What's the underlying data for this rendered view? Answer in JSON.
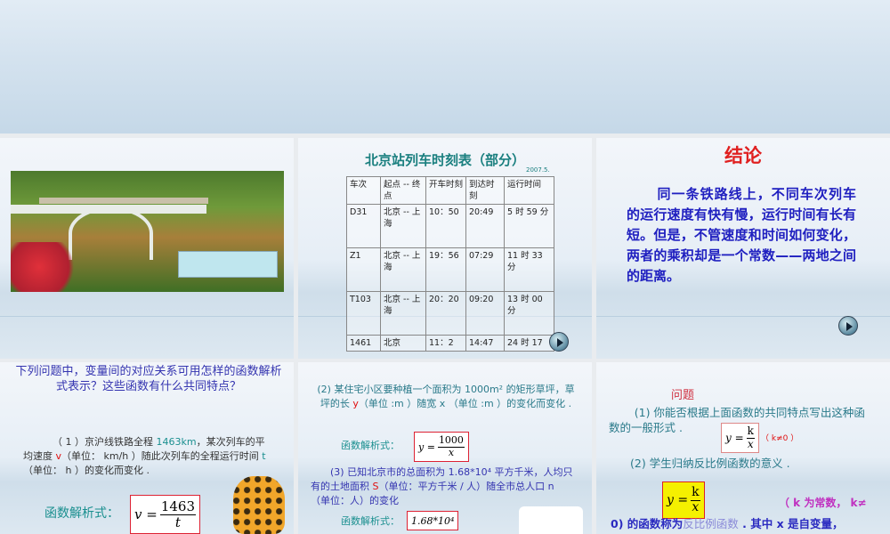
{
  "slide2": {
    "title": "北京站列车时刻表（部分）",
    "date": "2007.5.",
    "headers": [
      "车次",
      "起点 -- 终点",
      "开车时刻",
      "到达时刻",
      "运行时间"
    ],
    "rows": [
      [
        "D31",
        "北京 -- 上海",
        "10：50",
        "20:49",
        "5 时 59 分"
      ],
      [
        "Z1",
        "北京 -- 上海",
        "19：56",
        "07:29",
        "11 时 33 分"
      ],
      [
        "T103",
        "北京 -- 上海",
        "20：20",
        "09:20",
        "13 时 00 分"
      ],
      [
        "1461",
        "北京",
        "11：2",
        "14:47",
        "24 时 17"
      ]
    ]
  },
  "slide3": {
    "title": "结论",
    "body": "同一条铁路线上，不同车次列车的运行速度有快有慢，运行时间有长有短。但是，不管速度和时间如何变化，两者的乘积却是一个常数——两地之间的距离。"
  },
  "slide4": {
    "question": "下列问题中，变量间的对应关系可用怎样的函数解析式表示？这些函数有什么共同特点？",
    "p1_a": "（ 1 ）京沪线铁路全程 ",
    "p1_num": "1463km",
    "p1_b": "，某次列车的平均速度 ",
    "p1_v": "v",
    "p1_c": "（单位： km/h ）随此次列车的全程运行时间 ",
    "p1_t": "t",
    "p1_d": "（单位： h ）的变化而变化 .",
    "formula_label": "函数解析式：",
    "formula_lhs": "v =",
    "formula_num": "1463",
    "formula_den": "t"
  },
  "slide5": {
    "p2_a": "(2) 某住宅小区要种植一个面积为 1000m² 的矩形草坪，草坪的长 ",
    "p2_y": "y",
    "p2_b": "（单位 :m ）随宽 x （单位 :m ）的变化而变化 .",
    "formula_label": "函数解析式：",
    "formula_lhs": "y =",
    "formula_num": "1000",
    "formula_den": "x",
    "p3_a": "(3) 已知北京市的总面积为 1.68*10⁴ 平方千米，人均只有的土地面积 ",
    "p3_s": "S",
    "p3_b": "（单位：平方千米 / 人）随全市总人口 n （单位：人）的变化",
    "formula2_label": "函数解析式：",
    "formula2_num": "1.68*10⁴"
  },
  "slide6": {
    "title": "问题",
    "q1": "(1) 你能否根据上面函数的共同特点写出这种函数的一般形式 .",
    "f_lhs": "y =",
    "f_num": "k",
    "f_den": "x",
    "k_cond": "（ k≠0 ）",
    "q2": "(2) 学生归纳反比例函数的意义 .",
    "def_a": "（ k 为常数， k≠",
    "def_b": "0) 的函数称为",
    "def_c": "反比例函数",
    "def_d": " . 其中 x 是自变量，"
  }
}
